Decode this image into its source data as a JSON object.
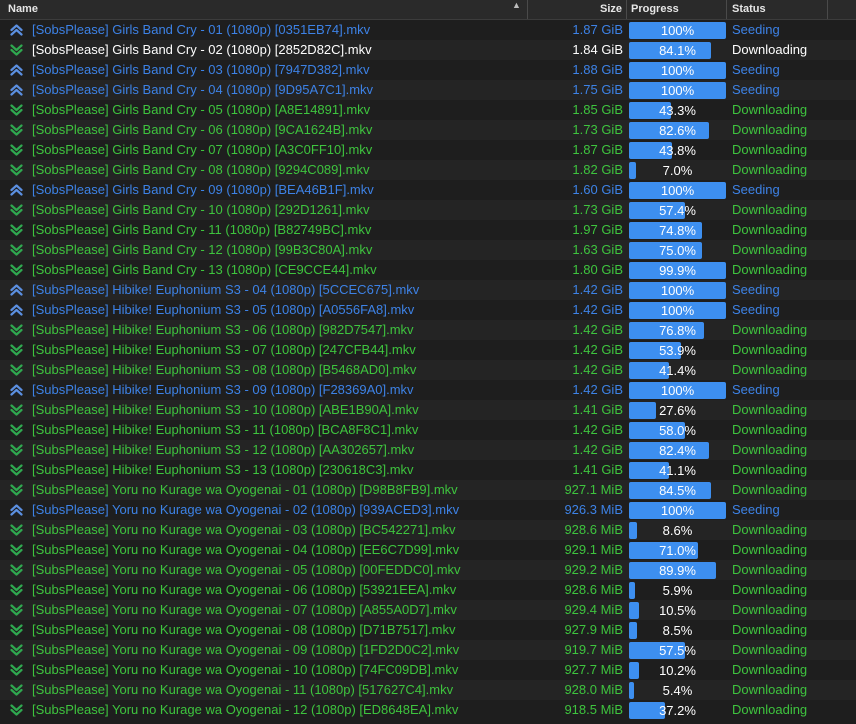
{
  "columns": {
    "name": "Name",
    "size": "Size",
    "progress": "Progress",
    "status": "Status"
  },
  "colors": {
    "seeding": "#3d82e6",
    "downloading": "#3ec43e",
    "selected_text": "#ffffff",
    "progress_bar": "#3d8ff0"
  },
  "icons": {
    "seeding": "upload-chevrons-icon",
    "downloading": "download-chevrons-icon",
    "sort": "sort-ascending-icon"
  },
  "rows": [
    {
      "name": "[SobsPlease] Girls Band Cry - 01 (1080p) [0351EB74].mkv",
      "size": "1.87 GiB",
      "progress": "100%",
      "pct": 100,
      "status": "Seeding",
      "state": "seeding"
    },
    {
      "name": "[SobsPlease] Girls Band Cry - 02 (1080p) [2852D82C].mkv",
      "size": "1.84 GiB",
      "progress": "84.1%",
      "pct": 84.1,
      "status": "Downloading",
      "state": "selected"
    },
    {
      "name": "[SobsPlease] Girls Band Cry - 03 (1080p) [7947D382].mkv",
      "size": "1.88 GiB",
      "progress": "100%",
      "pct": 100,
      "status": "Seeding",
      "state": "seeding"
    },
    {
      "name": "[SobsPlease] Girls Band Cry - 04 (1080p) [9D95A7C1].mkv",
      "size": "1.75 GiB",
      "progress": "100%",
      "pct": 100,
      "status": "Seeding",
      "state": "seeding"
    },
    {
      "name": "[SobsPlease] Girls Band Cry - 05 (1080p) [A8E14891].mkv",
      "size": "1.85 GiB",
      "progress": "43.3%",
      "pct": 43.3,
      "status": "Downloading",
      "state": "downloading"
    },
    {
      "name": "[SobsPlease] Girls Band Cry - 06 (1080p) [9CA1624B].mkv",
      "size": "1.73 GiB",
      "progress": "82.6%",
      "pct": 82.6,
      "status": "Downloading",
      "state": "downloading"
    },
    {
      "name": "[SobsPlease] Girls Band Cry - 07 (1080p) [A3C0FF10].mkv",
      "size": "1.87 GiB",
      "progress": "43.8%",
      "pct": 43.8,
      "status": "Downloading",
      "state": "downloading"
    },
    {
      "name": "[SobsPlease] Girls Band Cry - 08 (1080p) [9294C089].mkv",
      "size": "1.82 GiB",
      "progress": "7.0%",
      "pct": 7.0,
      "status": "Downloading",
      "state": "downloading"
    },
    {
      "name": "[SobsPlease] Girls Band Cry - 09 (1080p) [BEA46B1F].mkv",
      "size": "1.60 GiB",
      "progress": "100%",
      "pct": 100,
      "status": "Seeding",
      "state": "seeding"
    },
    {
      "name": "[SobsPlease] Girls Band Cry - 10 (1080p) [292D1261].mkv",
      "size": "1.73 GiB",
      "progress": "57.4%",
      "pct": 57.4,
      "status": "Downloading",
      "state": "downloading"
    },
    {
      "name": "[SobsPlease] Girls Band Cry - 11 (1080p) [B82749BC].mkv",
      "size": "1.97 GiB",
      "progress": "74.8%",
      "pct": 74.8,
      "status": "Downloading",
      "state": "downloading"
    },
    {
      "name": "[SobsPlease] Girls Band Cry - 12 (1080p) [99B3C80A].mkv",
      "size": "1.63 GiB",
      "progress": "75.0%",
      "pct": 75.0,
      "status": "Downloading",
      "state": "downloading"
    },
    {
      "name": "[SobsPlease] Girls Band Cry - 13 (1080p) [CE9CCE44].mkv",
      "size": "1.80 GiB",
      "progress": "99.9%",
      "pct": 99.9,
      "status": "Downloading",
      "state": "downloading"
    },
    {
      "name": "[SubsPlease] Hibike! Euphonium S3 - 04 (1080p) [5CCEC675].mkv",
      "size": "1.42 GiB",
      "progress": "100%",
      "pct": 100,
      "status": "Seeding",
      "state": "seeding"
    },
    {
      "name": "[SubsPlease] Hibike! Euphonium S3 - 05 (1080p) [A0556FA8].mkv",
      "size": "1.42 GiB",
      "progress": "100%",
      "pct": 100,
      "status": "Seeding",
      "state": "seeding"
    },
    {
      "name": "[SubsPlease] Hibike! Euphonium S3 - 06 (1080p) [982D7547].mkv",
      "size": "1.42 GiB",
      "progress": "76.8%",
      "pct": 76.8,
      "status": "Downloading",
      "state": "downloading"
    },
    {
      "name": "[SubsPlease] Hibike! Euphonium S3 - 07 (1080p) [247CFB44].mkv",
      "size": "1.42 GiB",
      "progress": "53.9%",
      "pct": 53.9,
      "status": "Downloading",
      "state": "downloading"
    },
    {
      "name": "[SubsPlease] Hibike! Euphonium S3 - 08 (1080p) [B5468AD0].mkv",
      "size": "1.42 GiB",
      "progress": "41.4%",
      "pct": 41.4,
      "status": "Downloading",
      "state": "downloading"
    },
    {
      "name": "[SubsPlease] Hibike! Euphonium S3 - 09 (1080p) [F28369A0].mkv",
      "size": "1.42 GiB",
      "progress": "100%",
      "pct": 100,
      "status": "Seeding",
      "state": "seeding"
    },
    {
      "name": "[SubsPlease] Hibike! Euphonium S3 - 10 (1080p) [ABE1B90A].mkv",
      "size": "1.41 GiB",
      "progress": "27.6%",
      "pct": 27.6,
      "status": "Downloading",
      "state": "downloading"
    },
    {
      "name": "[SubsPlease] Hibike! Euphonium S3 - 11 (1080p) [BCA8F8C1].mkv",
      "size": "1.42 GiB",
      "progress": "58.0%",
      "pct": 58.0,
      "status": "Downloading",
      "state": "downloading"
    },
    {
      "name": "[SubsPlease] Hibike! Euphonium S3 - 12 (1080p) [AA302657].mkv",
      "size": "1.42 GiB",
      "progress": "82.4%",
      "pct": 82.4,
      "status": "Downloading",
      "state": "downloading"
    },
    {
      "name": "[SubsPlease] Hibike! Euphonium S3 - 13 (1080p) [230618C3].mkv",
      "size": "1.41 GiB",
      "progress": "41.1%",
      "pct": 41.1,
      "status": "Downloading",
      "state": "downloading"
    },
    {
      "name": "[SubsPlease] Yoru no Kurage wa Oyogenai - 01 (1080p) [D98B8FB9].mkv",
      "size": "927.1 MiB",
      "progress": "84.5%",
      "pct": 84.5,
      "status": "Downloading",
      "state": "downloading"
    },
    {
      "name": "[SubsPlease] Yoru no Kurage wa Oyogenai - 02 (1080p) [939ACED3].mkv",
      "size": "926.3 MiB",
      "progress": "100%",
      "pct": 100,
      "status": "Seeding",
      "state": "seeding"
    },
    {
      "name": "[SubsPlease] Yoru no Kurage wa Oyogenai - 03 (1080p) [BC542271].mkv",
      "size": "928.6 MiB",
      "progress": "8.6%",
      "pct": 8.6,
      "status": "Downloading",
      "state": "downloading"
    },
    {
      "name": "[SubsPlease] Yoru no Kurage wa Oyogenai - 04 (1080p) [EE6C7D99].mkv",
      "size": "929.1 MiB",
      "progress": "71.0%",
      "pct": 71.0,
      "status": "Downloading",
      "state": "downloading"
    },
    {
      "name": "[SubsPlease] Yoru no Kurage wa Oyogenai - 05 (1080p) [00FEDDC0].mkv",
      "size": "929.2 MiB",
      "progress": "89.9%",
      "pct": 89.9,
      "status": "Downloading",
      "state": "downloading"
    },
    {
      "name": "[SubsPlease] Yoru no Kurage wa Oyogenai - 06 (1080p) [53921EEA].mkv",
      "size": "928.6 MiB",
      "progress": "5.9%",
      "pct": 5.9,
      "status": "Downloading",
      "state": "downloading"
    },
    {
      "name": "[SubsPlease] Yoru no Kurage wa Oyogenai - 07 (1080p) [A855A0D7].mkv",
      "size": "929.4 MiB",
      "progress": "10.5%",
      "pct": 10.5,
      "status": "Downloading",
      "state": "downloading"
    },
    {
      "name": "[SubsPlease] Yoru no Kurage wa Oyogenai - 08 (1080p) [D71B7517].mkv",
      "size": "927.9 MiB",
      "progress": "8.5%",
      "pct": 8.5,
      "status": "Downloading",
      "state": "downloading"
    },
    {
      "name": "[SubsPlease] Yoru no Kurage wa Oyogenai - 09 (1080p) [1FD2D0C2].mkv",
      "size": "919.7 MiB",
      "progress": "57.5%",
      "pct": 57.5,
      "status": "Downloading",
      "state": "downloading"
    },
    {
      "name": "[SubsPlease] Yoru no Kurage wa Oyogenai - 10 (1080p) [74FC09DB].mkv",
      "size": "927.7 MiB",
      "progress": "10.2%",
      "pct": 10.2,
      "status": "Downloading",
      "state": "downloading"
    },
    {
      "name": "[SubsPlease] Yoru no Kurage wa Oyogenai - 11 (1080p) [517627C4].mkv",
      "size": "928.0 MiB",
      "progress": "5.4%",
      "pct": 5.4,
      "status": "Downloading",
      "state": "downloading"
    },
    {
      "name": "[SubsPlease] Yoru no Kurage wa Oyogenai - 12 (1080p) [ED8648EA].mkv",
      "size": "918.5 MiB",
      "progress": "37.2%",
      "pct": 37.2,
      "status": "Downloading",
      "state": "downloading"
    }
  ]
}
